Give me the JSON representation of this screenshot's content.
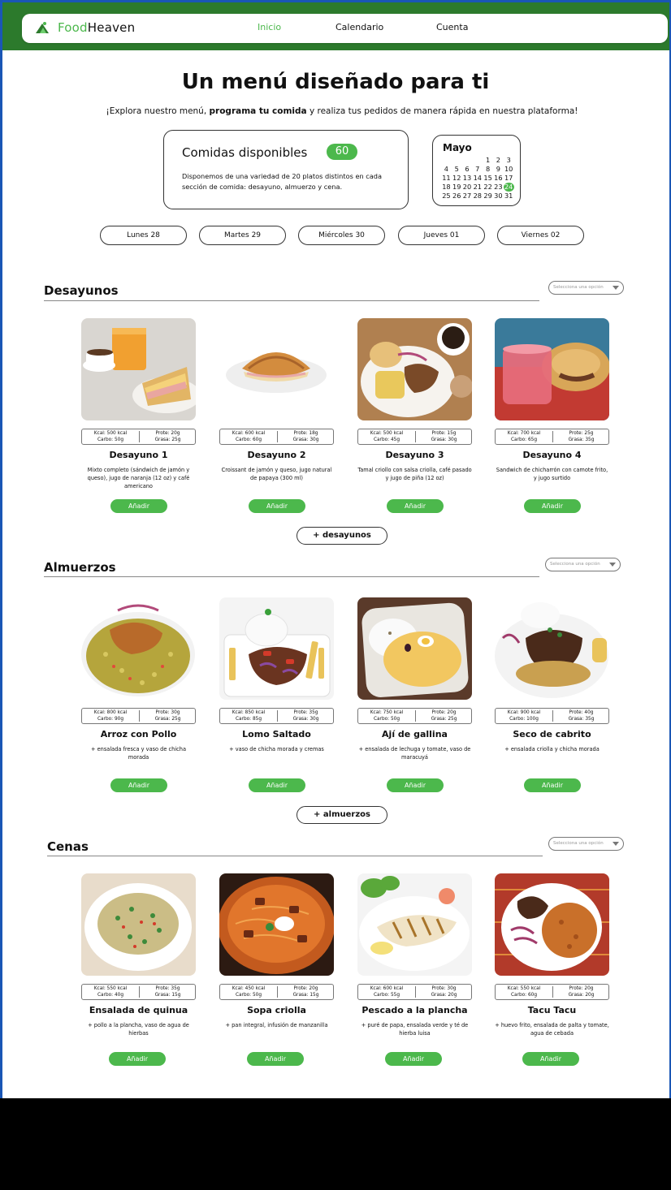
{
  "brand": {
    "food": "Food",
    "heaven": "Heaven"
  },
  "nav": {
    "inicio": "Inicio",
    "calendario": "Calendario",
    "cuenta": "Cuenta"
  },
  "hero": {
    "title": "Un menú diseñado para ti",
    "sub_a": "¡Explora nuestro menú, ",
    "sub_b": "programa tu comida",
    "sub_c": " y realiza tus pedidos de manera rápida en nuestra plataforma!"
  },
  "stats": {
    "title": "Comidas disponibles",
    "count": "60",
    "desc": "Disponemos de una variedad de 20 platos distintos en cada sección de comida: desayuno, almuerzo y cena."
  },
  "calendar": {
    "month": "Mayo",
    "days": [
      "",
      "",
      "",
      "",
      "1",
      "2",
      "3",
      "4",
      "5",
      "6",
      "7",
      "8",
      "9",
      "10",
      "11",
      "12",
      "13",
      "14",
      "15",
      "16",
      "17",
      "18",
      "19",
      "20",
      "21",
      "22",
      "23",
      "24",
      "25",
      "26",
      "27",
      "28",
      "29",
      "30",
      "31"
    ],
    "today": "24"
  },
  "days": [
    "Lunes 28",
    "Martes 29",
    "Miércoles 30",
    "Jueves 01",
    "Viernes 02"
  ],
  "select_placeholder": "Selecciona una opción",
  "add_label": "Añadir",
  "sections": [
    {
      "title": "Desayunos",
      "more": "+ desayunos",
      "items": [
        {
          "name": "Desayuno 1",
          "kcal": "Kcal: 500 kcal",
          "carbo": "Carbo: 50g",
          "prote": "Prote: 20g",
          "grasa": "Grasa: 25g",
          "desc": "Mixto completo (sándwich de jamón y queso), jugo de naranja (12 oz) y café americano"
        },
        {
          "name": "Desayuno 2",
          "kcal": "Kcal: 600 kcal",
          "carbo": "Carbo: 60g",
          "prote": "Prote: 18g",
          "grasa": "Grasa: 30g",
          "desc": "Croissant de jamón y queso, jugo natural de papaya (300 ml)"
        },
        {
          "name": "Desayuno 3",
          "kcal": "Kcal: 500 kcal",
          "carbo": "Carbo: 45g",
          "prote": "Prote: 15g",
          "grasa": "Grasa: 30g",
          "desc": "Tamal criollo con salsa criolla, café pasado y jugo de piña (12 oz)"
        },
        {
          "name": "Desayuno 4",
          "kcal": "Kcal: 700 kcal",
          "carbo": "Carbo: 65g",
          "prote": "Prote: 25g",
          "grasa": "Grasa: 35g",
          "desc": "Sandwich de chicharrón con camote frito, y jugo surtido"
        }
      ]
    },
    {
      "title": "Almuerzos",
      "more": "+ almuerzos",
      "items": [
        {
          "name": "Arroz con Pollo",
          "kcal": "Kcal: 800 kcal",
          "carbo": "Carbo: 90g",
          "prote": "Prote: 30g",
          "grasa": "Grasa: 25g",
          "desc": "+ ensalada fresca y vaso de chicha morada"
        },
        {
          "name": "Lomo Saltado",
          "kcal": "Kcal: 850 kcal",
          "carbo": "Carbo: 85g",
          "prote": "Prote: 35g",
          "grasa": "Grasa: 30g",
          "desc": "+ vaso de chicha morada y cremas"
        },
        {
          "name": "Ají de gallina",
          "kcal": "Kcal: 750 kcal",
          "carbo": "Carbo: 50g",
          "prote": "Prote: 20g",
          "grasa": "Grasa: 25g",
          "desc": "+ ensalada de lechuga y tomate, vaso de maracuyá"
        },
        {
          "name": "Seco de cabrito",
          "kcal": "Kcal: 900 kcal",
          "carbo": "Carbo: 100g",
          "prote": "Prote: 40g",
          "grasa": "Grasa: 35g",
          "desc": "+ ensalada criolla y chicha morada"
        }
      ]
    },
    {
      "title": "Cenas",
      "more": "",
      "items": [
        {
          "name": "Ensalada de quinua",
          "kcal": "Kcal: 550 kcal",
          "carbo": "Carbo: 40g",
          "prote": "Prote: 35g",
          "grasa": "Grasa: 15g",
          "desc": "+ pollo a la plancha, vaso de agua de hierbas"
        },
        {
          "name": "Sopa criolla",
          "kcal": "Kcal: 450 kcal",
          "carbo": "Carbo: 50g",
          "prote": "Prote: 20g",
          "grasa": "Grasa: 15g",
          "desc": "+ pan integral, infusión de manzanilla"
        },
        {
          "name": "Pescado a la plancha",
          "kcal": "Kcal: 600 kcal",
          "carbo": "Carbo: 55g",
          "prote": "Prote: 30g",
          "grasa": "Grasa: 20g",
          "desc": "+ puré de papa, ensalada verde y té de hierba luisa"
        },
        {
          "name": "Tacu Tacu",
          "kcal": "Kcal: 550 kcal",
          "carbo": "Carbo: 60g",
          "prote": "Prote: 20g",
          "grasa": "Grasa: 20g",
          "desc": "+ huevo frito, ensalada de palta y tomate, agua de cebada"
        }
      ]
    }
  ],
  "colors": {
    "accent": "#4cb84c",
    "topbar": "#2c7a2c"
  }
}
